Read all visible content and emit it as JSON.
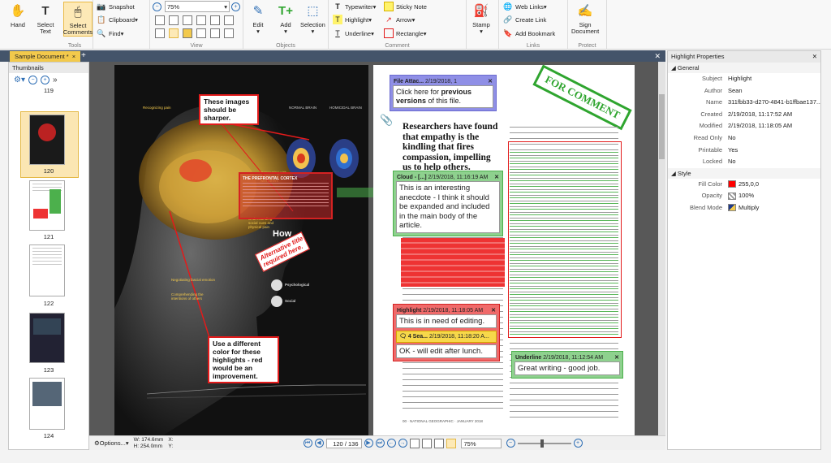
{
  "ribbon": {
    "hand": "Hand",
    "select_text": "Select\nText",
    "select_comments": "Select\nComments",
    "snapshot": "Snapshot",
    "clipboard": "Clipboard",
    "find": "Find",
    "tools_label": "Tools",
    "zoom_value": "75%",
    "view_label": "View",
    "edit": "Edit",
    "add": "Add",
    "selection": "Selection",
    "objects_label": "Objects",
    "typewriter": "Typewriter",
    "sticky_note": "Sticky Note",
    "highlight": "Highlight",
    "arrow": "Arrow",
    "underline": "Underline",
    "rectangle": "Rectangle",
    "comment_label": "Comment",
    "stamp": "Stamp",
    "web_links": "Web Links",
    "create_link": "Create Link",
    "add_bookmark": "Add Bookmark",
    "links_label": "Links",
    "sign_document": "Sign\nDocument",
    "protect_label": "Protect"
  },
  "tab": {
    "doc_name": "Sample Document *",
    "close": "×",
    "new": "+"
  },
  "thumbnails": {
    "title": "Thumbnails",
    "pages": [
      "119",
      "120",
      "121",
      "122",
      "123",
      "124"
    ],
    "selected": "120"
  },
  "left_page": {
    "callout_sharper": "These images\nshould be\nsharper.",
    "callout_color": "Use a different\ncolor for these\nhighlights - red\nwould be an\nimprovement.",
    "alt_title": "Alternative title\nrequired here.",
    "normal_brain": "NORMAL BRAIN",
    "homicidal_brain": "HOMICIDAL BRAIN",
    "prefrontal": "THE PREFRONTAL CORTEX",
    "how": "How",
    "recognizing": "Recognizing pain",
    "negotiating": "Negotiating fascial emotion",
    "comprehending": "Comprehending the\nintentions of others",
    "understanding": "Understanding\nsocial cues and\nphysical pain",
    "connecting": "Connecting with\nperspective\nwith others",
    "psychological": "Psychological",
    "social": "Social"
  },
  "right_page": {
    "stamp": "FOR COMMENT",
    "file_attach_head": "File Attac...",
    "file_attach_date": "2/19/2018, 1",
    "file_attach_body_a": "Click here for ",
    "file_attach_body_b": "previous versions",
    "file_attach_body_c": " of this file.",
    "headline": "Researchers have found that empathy is the kindling that fires compassion, impelling us to help others.",
    "cloud_head": "Cloud - [...]",
    "cloud_date": "2/19/2018, 11:16:19 AM",
    "cloud_body": "This is an interesting anecdote - I think it should be expanded and included in the main body of the article.",
    "highlight_head": "Highlight",
    "highlight_date": "2/19/2018, 11:18:05 AM",
    "highlight_body": "This is in need of editing.",
    "reply_head": "4 Sea...",
    "reply_date": "2/19/2018, 11:18:20 A...",
    "reply_body": "OK - will edit after lunch.",
    "underline_head": "Underline",
    "underline_date": "2/19/2018, 11:12:54 AM",
    "underline_body": "Great writing - good job.",
    "footer": "00 · NATIONAL GEOGRAPHIC · JANUARY 2018"
  },
  "statusbar": {
    "options": "Options...",
    "width": "W: 174.6mm",
    "height": "H: 254.0mm",
    "x": "X:",
    "y": "Y:",
    "page": "120 / 136",
    "zoom": "75%"
  },
  "properties": {
    "title": "Highlight Properties",
    "general": "General",
    "rows": [
      {
        "k": "Subject",
        "v": "Highlight"
      },
      {
        "k": "Author",
        "v": "Sean"
      },
      {
        "k": "Name",
        "v": "311fbb33-d270-4841-b1ffbae137..."
      },
      {
        "k": "Created",
        "v": "2/19/2018, 11:17:52 AM"
      },
      {
        "k": "Modified",
        "v": "2/19/2018, 11:18:05 AM"
      },
      {
        "k": "Read Only",
        "v": "No"
      },
      {
        "k": "Printable",
        "v": "Yes"
      },
      {
        "k": "Locked",
        "v": "No"
      }
    ],
    "style": "Style",
    "fill_color_key": "Fill Color",
    "fill_color_val": "255,0,0",
    "fill_color": "#ff0000",
    "opacity_key": "Opacity",
    "opacity_val": "100%",
    "blend_key": "Blend Mode",
    "blend_val": "Multiply"
  }
}
